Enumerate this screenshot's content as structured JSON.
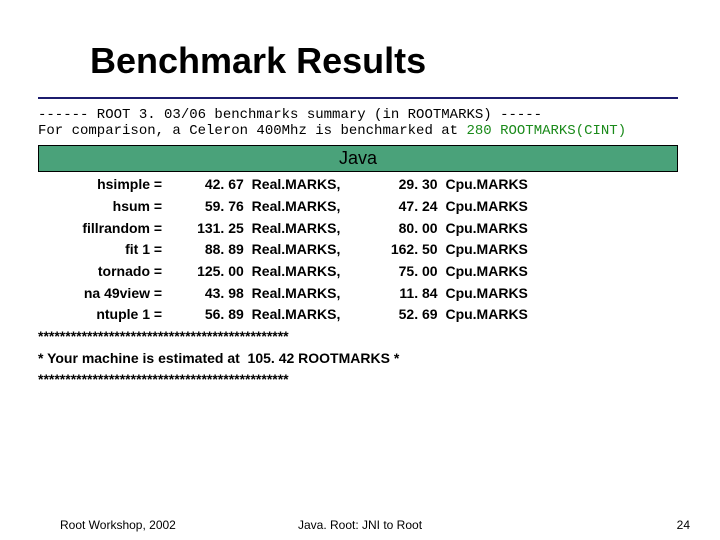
{
  "title": "Benchmark Results",
  "header": {
    "line1_pre": "------ ROOT 3. 03/06 benchmarks summary (in ROOTMARKS) -----",
    "line2_pre": "For comparison, a Celeron 400Mhz is benchmarked at ",
    "line2_green": "280 ROOTMARKS(CINT)"
  },
  "java_bar": "Java",
  "rows": [
    {
      "name": "hsimple",
      "v1": "42. 67",
      "u1": "Real.MARKS,",
      "v2": "29. 30",
      "u2": "Cpu.MARKS"
    },
    {
      "name": "hsum",
      "v1": "59. 76",
      "u1": "Real.MARKS,",
      "v2": "47. 24",
      "u2": "Cpu.MARKS"
    },
    {
      "name": "fillrandom",
      "v1": "131. 25",
      "u1": "Real.MARKS,",
      "v2": "80. 00",
      "u2": "Cpu.MARKS"
    },
    {
      "name": "fit 1",
      "v1": "88. 89",
      "u1": "Real.MARKS,",
      "v2": "162. 50",
      "u2": "Cpu.MARKS"
    },
    {
      "name": "tornado",
      "v1": "125. 00",
      "u1": "Real.MARKS,",
      "v2": "75. 00",
      "u2": "Cpu.MARKS"
    },
    {
      "name": "na 49view",
      "v1": "43. 98",
      "u1": "Real.MARKS,",
      "v2": "11. 84",
      "u2": "Cpu.MARKS"
    },
    {
      "name": "ntuple 1",
      "v1": "56. 89",
      "u1": "Real.MARKS,",
      "v2": "52. 69",
      "u2": "Cpu.MARKS"
    }
  ],
  "stars": {
    "bar": "**********************************************",
    "line": "* Your machine is estimated at  105. 42 ROOTMARKS *"
  },
  "footer": {
    "left": "Root Workshop, 2002",
    "mid": "Java. Root: JNI to Root",
    "right": "24"
  },
  "chart_data": {
    "type": "table",
    "title": "Benchmark Results",
    "columns": [
      "benchmark",
      "RealMARKS",
      "CpuMARKS"
    ],
    "rows": [
      [
        "hsimple",
        42.67,
        29.3
      ],
      [
        "hsum",
        59.76,
        47.24
      ],
      [
        "fillrandom",
        131.25,
        80.0
      ],
      [
        "fit1",
        88.89,
        162.5
      ],
      [
        "tornado",
        125.0,
        75.0
      ],
      [
        "na49view",
        43.98,
        11.84
      ],
      [
        "ntuple1",
        56.89,
        52.69
      ]
    ],
    "summary": {
      "estimated_rootmarks": 105.42
    },
    "reference": {
      "machine": "Celeron 400Mhz",
      "rootmarks_cint": 280
    }
  }
}
